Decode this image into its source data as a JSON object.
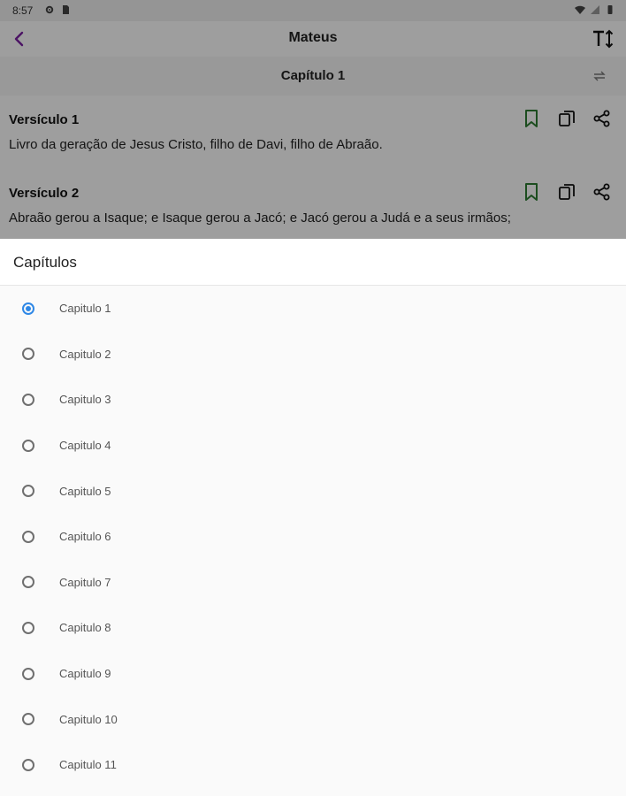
{
  "status_bar": {
    "time": "8:57"
  },
  "app_bar": {
    "title": "Mateus"
  },
  "chapter_header": {
    "title": "Capítulo 1"
  },
  "verses": [
    {
      "title": "Versículo 1",
      "text": "Livro da geração de Jesus Cristo, filho de Davi, filho de Abraão."
    },
    {
      "title": "Versículo 2",
      "text": "Abraão gerou a Isaque; e Isaque gerou a Jacó; e Jacó gerou a Judá e a seus irmãos;"
    }
  ],
  "sheet": {
    "title": "Capítulos",
    "selected_index": 0,
    "options": [
      "Capitulo 1",
      "Capitulo 2",
      "Capitulo 3",
      "Capitulo 4",
      "Capitulo 5",
      "Capitulo 6",
      "Capitulo 7",
      "Capitulo 8",
      "Capitulo 9",
      "Capitulo 10",
      "Capitulo 11"
    ]
  },
  "colors": {
    "accent_purple": "#7b1fa2",
    "bookmark_green": "#2e7d32",
    "radio_selected": "#2f88e6"
  }
}
